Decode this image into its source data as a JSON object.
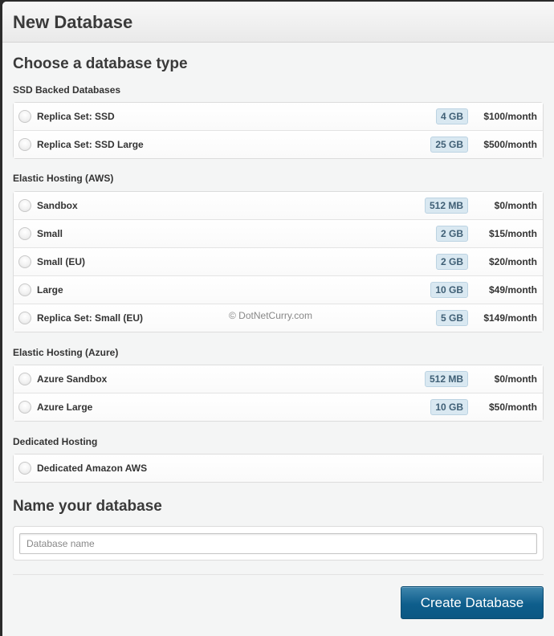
{
  "modal": {
    "title": "New Database"
  },
  "choose_section": {
    "title": "Choose a database type",
    "groups": [
      {
        "label": "SSD Backed Databases",
        "options": [
          {
            "name": "Replica Set: SSD",
            "size": "4 GB",
            "price": "$100/month",
            "selected": false
          },
          {
            "name": "Replica Set: SSD Large",
            "size": "25 GB",
            "price": "$500/month",
            "selected": false
          }
        ]
      },
      {
        "label": "Elastic Hosting (AWS)",
        "options": [
          {
            "name": "Sandbox",
            "size": "512 MB",
            "price": "$0/month",
            "selected": false
          },
          {
            "name": "Small",
            "size": "2 GB",
            "price": "$15/month",
            "selected": false
          },
          {
            "name": "Small (EU)",
            "size": "2 GB",
            "price": "$20/month",
            "selected": false
          },
          {
            "name": "Large",
            "size": "10 GB",
            "price": "$49/month",
            "selected": false
          },
          {
            "name": "Replica Set: Small (EU)",
            "size": "5 GB",
            "price": "$149/month",
            "selected": false
          }
        ]
      },
      {
        "label": "Elastic Hosting (Azure)",
        "options": [
          {
            "name": "Azure Sandbox",
            "size": "512 MB",
            "price": "$0/month",
            "selected": false
          },
          {
            "name": "Azure Large",
            "size": "10 GB",
            "price": "$50/month",
            "selected": false
          }
        ]
      },
      {
        "label": "Dedicated Hosting",
        "options": [
          {
            "name": "Dedicated Amazon AWS",
            "selected": false
          }
        ]
      }
    ]
  },
  "watermark": "© DotNetCurry.com",
  "name_section": {
    "title": "Name your database",
    "input_value": "",
    "input_placeholder": "Database name"
  },
  "footer": {
    "create_label": "Create Database"
  },
  "colors": {
    "primary_button": "#0e5e8c",
    "badge_bg": "#d9e8f1",
    "badge_text": "#3f5f75"
  }
}
